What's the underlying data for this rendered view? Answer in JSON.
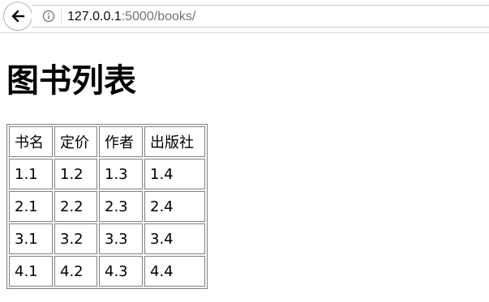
{
  "browser": {
    "url_host": "127.0.0.1",
    "url_path": ":5000/books/"
  },
  "page": {
    "title": "图书列表",
    "table": {
      "headers": [
        "书名",
        "定价",
        "作者",
        "出版社"
      ],
      "rows": [
        [
          "1.1",
          "1.2",
          "1.3",
          "1.4"
        ],
        [
          "2.1",
          "2.2",
          "2.3",
          "2.4"
        ],
        [
          "3.1",
          "3.2",
          "3.3",
          "3.4"
        ],
        [
          "4.1",
          "4.2",
          "4.3",
          "4.4"
        ]
      ]
    }
  },
  "icons": {
    "back": "arrow-left-icon",
    "info": "info-icon"
  },
  "colors": {
    "border": "#808080",
    "url_path": "#737373"
  }
}
